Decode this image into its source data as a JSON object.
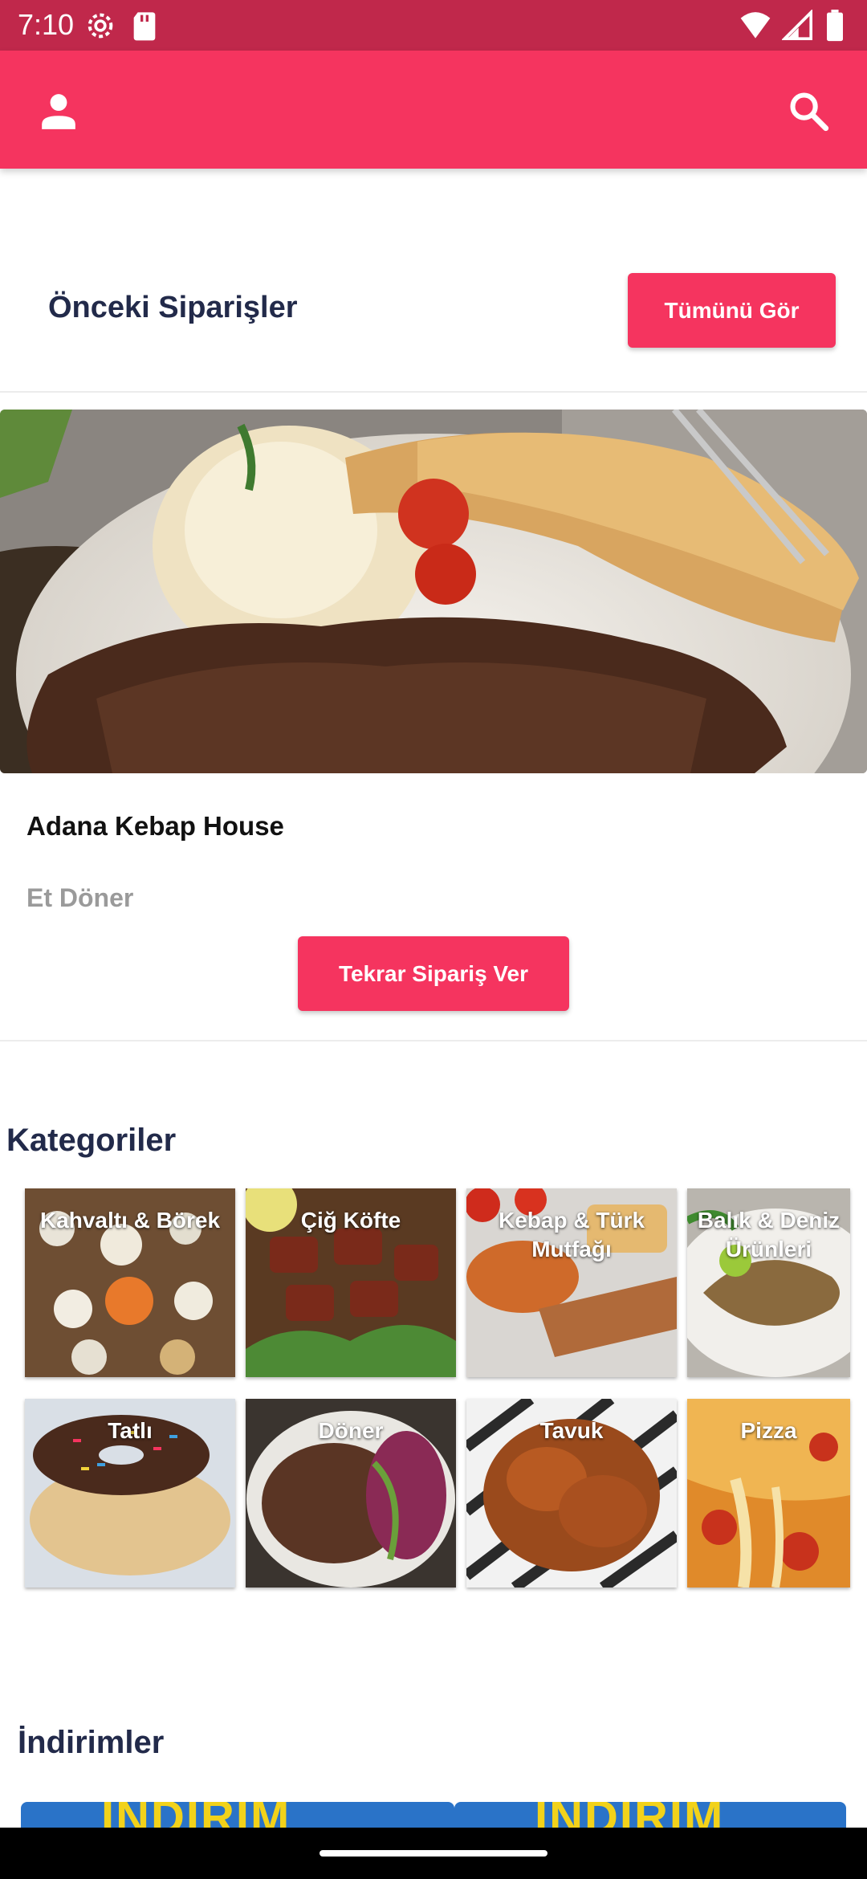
{
  "status_bar": {
    "time": "7:10",
    "left_icons": [
      "settings-icon",
      "sd-card-icon"
    ],
    "right_icons": [
      "wifi-icon",
      "signal-icon",
      "battery-icon"
    ]
  },
  "app_bar": {
    "left_icon": "person-icon",
    "right_icon": "search-icon",
    "color": "#f5345f"
  },
  "previous_orders": {
    "title": "Önceki Siparişler",
    "see_all_label": "Tümünü Gör",
    "order": {
      "restaurant": "Adana Kebap House",
      "item": "Et Döner",
      "reorder_label": "Tekrar Sipariş Ver"
    }
  },
  "categories": {
    "title": "Kategoriler",
    "items": [
      {
        "label": "Kahvaltı & Börek"
      },
      {
        "label": "Çiğ Köfte"
      },
      {
        "label": "Kebap & Türk Mutfağı"
      },
      {
        "label": "Balık & Deniz Ürünleri"
      },
      {
        "label": "Tatlı"
      },
      {
        "label": "Döner"
      },
      {
        "label": "Tavuk"
      },
      {
        "label": "Pizza"
      }
    ]
  },
  "discounts": {
    "title": "İndirimler",
    "banner_text": "İNDİRİM"
  },
  "colors": {
    "status_bar": "#c0284b",
    "accent": "#f5345f",
    "title_text": "#222a4a"
  }
}
